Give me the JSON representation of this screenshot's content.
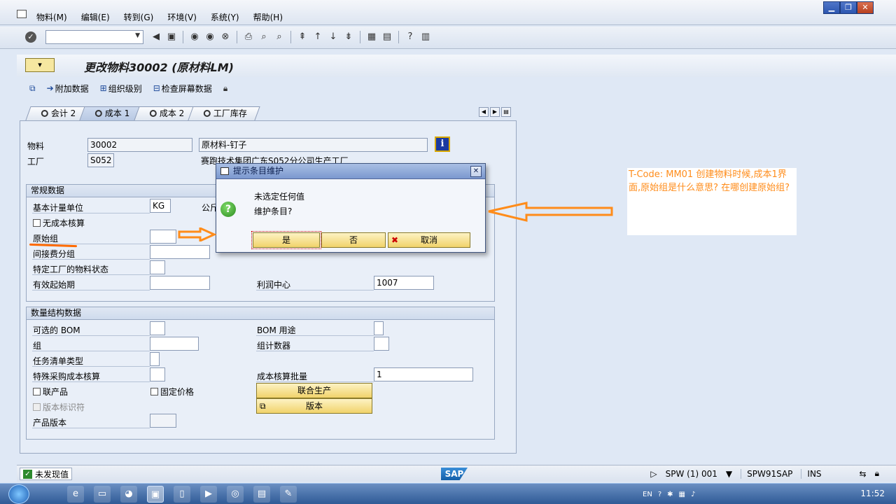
{
  "menubar": {
    "items": [
      "物料(M)",
      "编辑(E)",
      "转到(G)",
      "环境(V)",
      "系统(Y)",
      "帮助(H)"
    ]
  },
  "toolbar": {
    "command_value": ""
  },
  "header": {
    "title": "更改物料30002 (原材料LM)"
  },
  "app_toolbar": {
    "additional_data": "附加数据",
    "org_levels": "组织级别",
    "check_screen_data": "检查屏幕数据"
  },
  "tabs": [
    "会计 2",
    "成本 1",
    "成本 2",
    "工厂库存"
  ],
  "active_tab": "成本 1",
  "form": {
    "material_label": "物料",
    "material_value": "30002",
    "material_desc": "原材料-钉子",
    "plant_label": "工厂",
    "plant_value": "S052",
    "plant_desc": "赛跑技术集团广东S052分公司生产工厂",
    "general_title": "常规数据",
    "base_uom_label": "基本计量单位",
    "base_uom_value": "KG",
    "base_uom_desc": "公斤",
    "no_costing": "无成本核算",
    "origin_group_label": "原始组",
    "overhead_group_label": "间接费分组",
    "plant_status_label": "特定工厂的物料状态",
    "valid_from_label": "有效起始期",
    "profit_center_label": "利润中心",
    "profit_center_value": "1007",
    "qty_title": "数量结构数据",
    "alt_bom_label": "可选的 BOM",
    "bom_usage_label": "BOM 用途",
    "group_label": "组",
    "group_counter_label": "组计数器",
    "task_list_type_label": "任务清单类型",
    "special_proc_label": "特殊采购成本核算",
    "costing_lot_label": "成本核算批量",
    "costing_lot_value": "1",
    "co_product": "联产品",
    "fixed_price": "固定价格",
    "joint_production": "联合生产",
    "version_indicator": "版本标识符",
    "version_button": "版本",
    "production_version_label": "产品版本"
  },
  "dialog": {
    "title": "提示条目维护",
    "line1": "未选定任何值",
    "line2": "维护条目?",
    "yes": "是",
    "no": "否",
    "cancel": "取消",
    "close": "✕"
  },
  "annotation": {
    "note": "T-Code: MM01 创建物料时候,成本1界面,原始组是什么意思? 在哪创建原始组?",
    "color": "#ff8c1a"
  },
  "statusbar": {
    "message": "未发现值",
    "logo": "SAP",
    "session": "SPW (1) 001",
    "server": "SPW91SAP",
    "mode": "INS"
  },
  "taskbar": {
    "lang": "EN",
    "clock": "11:52"
  }
}
